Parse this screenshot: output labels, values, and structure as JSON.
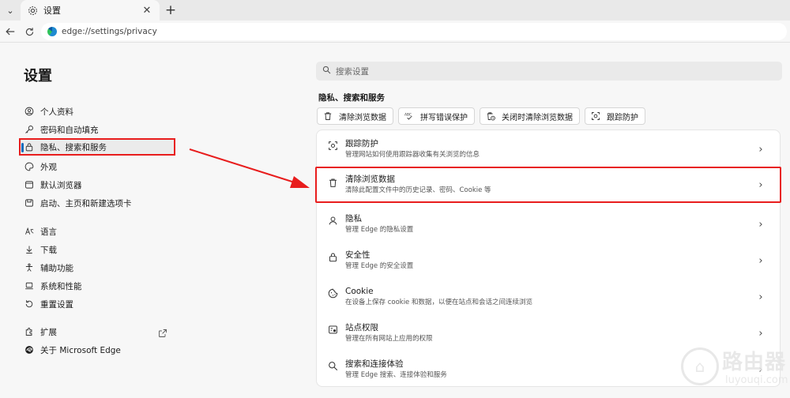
{
  "browser": {
    "tab_title": "设置",
    "url": "edge://settings/privacy"
  },
  "sidebar": {
    "title": "设置",
    "items": [
      {
        "label": "个人资料",
        "icon": "profile-icon"
      },
      {
        "label": "密码和自动填充",
        "icon": "key-icon"
      },
      {
        "label": "隐私、搜索和服务",
        "icon": "lock-icon",
        "active": true
      },
      {
        "label": "外观",
        "icon": "palette-icon"
      },
      {
        "label": "默认浏览器",
        "icon": "browser-icon"
      },
      {
        "label": "启动、主页和新建选项卡",
        "icon": "home-icon"
      },
      {
        "label": "语言",
        "icon": "language-icon"
      },
      {
        "label": "下载",
        "icon": "download-icon"
      },
      {
        "label": "辅助功能",
        "icon": "accessibility-icon"
      },
      {
        "label": "系统和性能",
        "icon": "laptop-icon"
      },
      {
        "label": "重置设置",
        "icon": "reset-icon"
      },
      {
        "label": "扩展",
        "icon": "puzzle-icon"
      },
      {
        "label": "关于 Microsoft Edge",
        "icon": "edge-logo-icon"
      }
    ]
  },
  "search": {
    "placeholder": "搜索设置"
  },
  "section": {
    "title": "隐私、搜索和服务",
    "chips": [
      {
        "label": "清除浏览数据",
        "icon": "trash-icon"
      },
      {
        "label": "拼写错误保护",
        "icon": "spellcheck-icon"
      },
      {
        "label": "关闭时清除浏览数据",
        "icon": "trash-clock-icon"
      },
      {
        "label": "跟踪防护",
        "icon": "tracking-icon"
      }
    ],
    "rows": [
      {
        "title": "跟踪防护",
        "desc": "管理网站如何使用跟踪器收集有关浏览的信息",
        "icon": "tracking-icon"
      },
      {
        "title": "清除浏览数据",
        "desc": "清除此配置文件中的历史记录、密码、Cookie 等",
        "icon": "trash-icon",
        "highlighted": true
      },
      {
        "title": "隐私",
        "desc": "管理 Edge 的隐私设置",
        "icon": "privacy-icon"
      },
      {
        "title": "安全性",
        "desc": "管理 Edge 的安全设置",
        "icon": "lock-icon"
      },
      {
        "title": "Cookie",
        "desc": "在设备上保存 cookie 和数据，以便在站点和会话之间连续浏览",
        "icon": "cookie-icon"
      },
      {
        "title": "站点权限",
        "desc": "管理在所有网站上应用的权限",
        "icon": "site-permissions-icon"
      },
      {
        "title": "搜索和连接体验",
        "desc": "管理 Edge 搜索、连接体验和服务",
        "icon": "search-icon"
      }
    ]
  },
  "watermark": {
    "brand": "路由器",
    "site": "luyouqi.com"
  },
  "colors": {
    "highlight": "#e81d1d",
    "accent": "#0f6cbd"
  }
}
